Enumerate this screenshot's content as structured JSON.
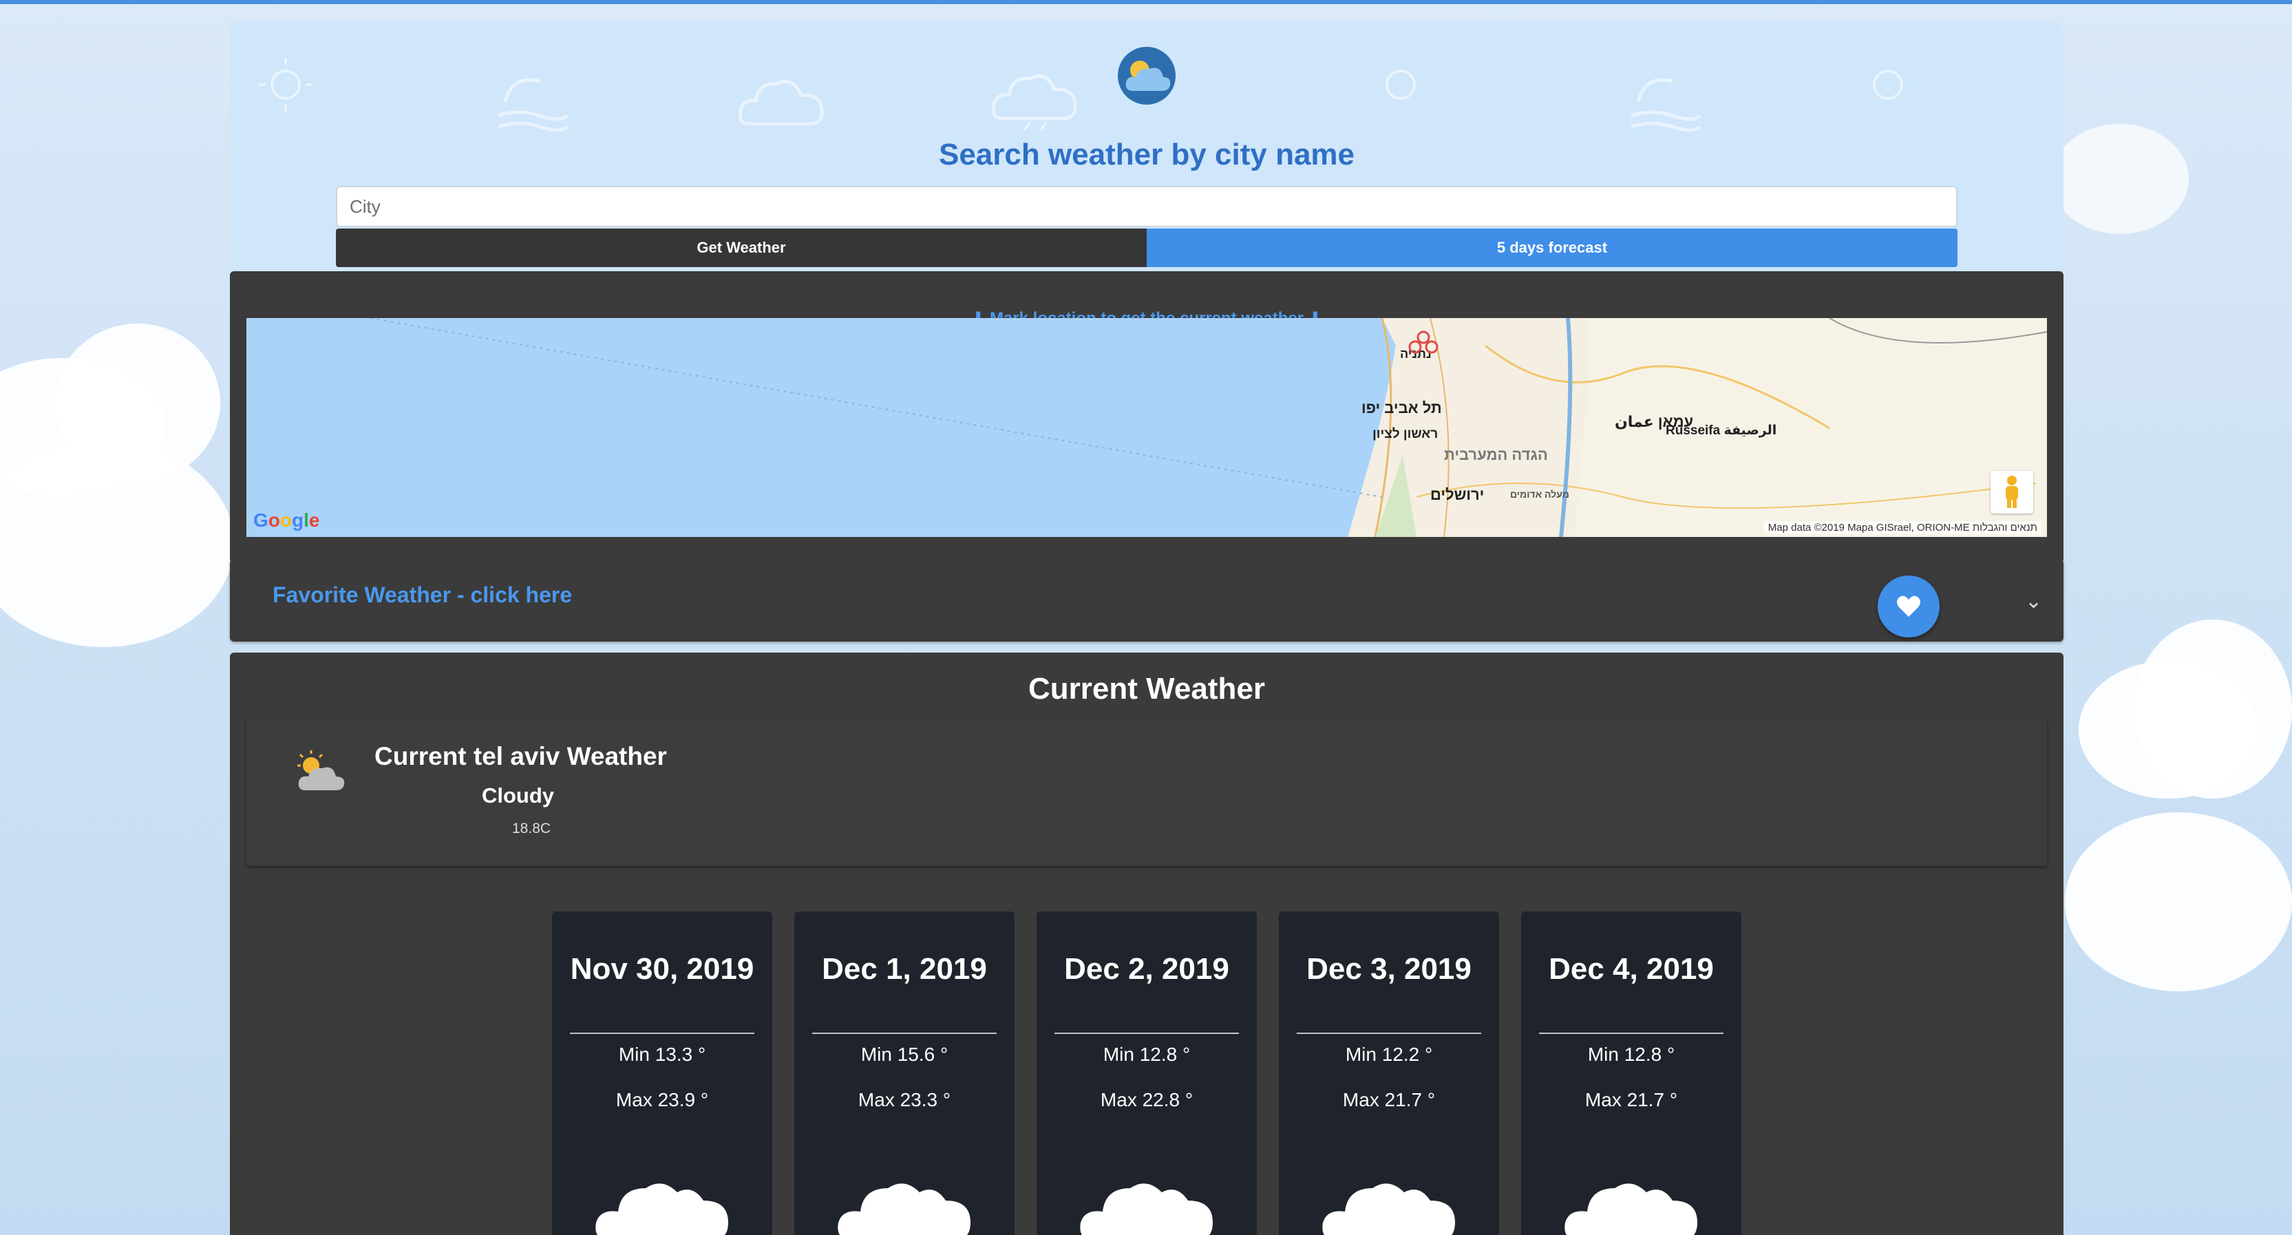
{
  "search": {
    "title": "Search weather by city name",
    "placeholder": "City",
    "get_weather_label": "Get Weather",
    "forecast_label": "5 days forecast"
  },
  "map": {
    "hint_arrow": "⬇",
    "hint_text": "Mark location to get the current weather",
    "credit": "Map data ©2019 Mapa GISrael, ORION-ME   תנאים והגבלות",
    "google_letters": [
      "G",
      "o",
      "o",
      "g",
      "l",
      "e"
    ],
    "labels": {
      "tel_aviv": "תל אביב יפו",
      "rishon": "ראשון לציון",
      "westbank": "הגדה המערבית",
      "jerusalem": "ירושלים",
      "amman": "עמאן عمان",
      "russeifa": "Russeifa الرصيفة",
      "netanya": "נתניה",
      "maale": "מעלה אדומים"
    }
  },
  "favorites": {
    "link_text": "Favorite Weather - click here",
    "chevron": "⌄"
  },
  "current": {
    "heading": "Current Weather",
    "title": "Current tel aviv Weather",
    "condition": "Cloudy",
    "temperature": "18.8C"
  },
  "forecast": [
    {
      "date": "Nov 30, 2019",
      "min": "Min 13.3 °",
      "max": "Max 23.9 °"
    },
    {
      "date": "Dec 1, 2019",
      "min": "Min 15.6 °",
      "max": "Max 23.3 °"
    },
    {
      "date": "Dec 2, 2019",
      "min": "Min 12.8 °",
      "max": "Max 22.8 °"
    },
    {
      "date": "Dec 3, 2019",
      "min": "Min 12.2 °",
      "max": "Max 21.7 °"
    },
    {
      "date": "Dec 4, 2019",
      "min": "Min 12.8 °",
      "max": "Max 21.7 °"
    }
  ],
  "colors": {
    "accent": "#3f8ee8",
    "dark_panel": "#3b3b3b",
    "forecast_card": "#1f242c",
    "title_blue": "#2f6fc4"
  },
  "icons": {
    "logo": "cloud-sun-icon",
    "favorite": "heart-icon",
    "current": "partly-cloudy-icon",
    "forecast": "cloud-icon"
  }
}
